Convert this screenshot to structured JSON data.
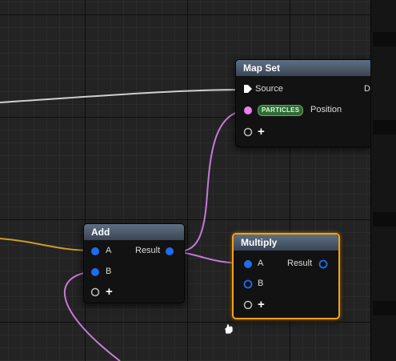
{
  "nodes": {
    "map_set": {
      "title": "Map Set",
      "pins": [
        {
          "label": "Source"
        },
        {
          "badge": "PARTICLES",
          "label": "Position"
        }
      ],
      "truncated_right": "D"
    },
    "add": {
      "title": "Add",
      "inputs": [
        "A",
        "B"
      ],
      "output": "Result"
    },
    "multiply": {
      "title": "Multiply",
      "inputs": [
        "A",
        "B"
      ],
      "output": "Result"
    }
  },
  "add_pin_glyph": "+",
  "colors": {
    "float_pin": "#1e6cf0",
    "particles_pin": "#ee7ff0",
    "wire_pink": "#c57ad8",
    "wire_yellow": "#cf9a2a",
    "wire_white": "#cfcfcf",
    "selection": "#f4a216"
  }
}
